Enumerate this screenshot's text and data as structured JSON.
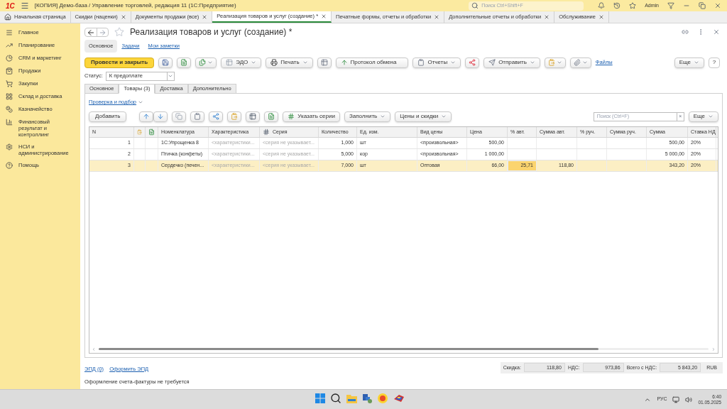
{
  "top_bar": {
    "logo": "1С",
    "title": "[КОПИЯ] Демо-база / Управление торговлей, редакция 11  (1С:Предприятие)",
    "search_placeholder": "Поиск Ctrl+Shift+F",
    "user": "Admin"
  },
  "tabs": [
    {
      "label": "Начальная страница",
      "selected": false,
      "closable": false
    },
    {
      "label": "Скидки (наценки)",
      "selected": false,
      "closable": true
    },
    {
      "label": "Документы продажи (все)",
      "selected": false,
      "closable": true
    },
    {
      "label": "Реализация товаров и услуг (создание) *",
      "selected": true,
      "closable": true
    },
    {
      "label": "Печатные формы, отчеты и обработки",
      "selected": false,
      "closable": true
    },
    {
      "label": "Дополнительные отчеты и обработки",
      "selected": false,
      "closable": true
    },
    {
      "label": "Обслуживание",
      "selected": false,
      "closable": true
    }
  ],
  "sidebar": {
    "items": [
      {
        "label": "Главное"
      },
      {
        "label": "Планирование"
      },
      {
        "label": "CRM и маркетинг"
      },
      {
        "label": "Продажи"
      },
      {
        "label": "Закупки"
      },
      {
        "label": "Склад и доставка"
      },
      {
        "label": "Казначейство"
      },
      {
        "label": "Финансовый результат и контроллинг"
      },
      {
        "label": "НСИ и администрирование"
      },
      {
        "label": "Помощь"
      }
    ]
  },
  "form": {
    "title": "Реализация товаров и услуг (создание) *",
    "sections": [
      {
        "label": "Основное",
        "selected": true
      },
      {
        "label": "Задачи",
        "selected": false
      },
      {
        "label": "Мои заметки",
        "selected": false
      }
    ],
    "toolbar": {
      "post_and_close": "Провести и закрыть",
      "edo": "ЭДО",
      "print": "Печать",
      "exchange_log": "Протокол обмена",
      "reports": "Отчеты",
      "send": "Отправить",
      "files": "Файлы",
      "more": "Еще",
      "help": "?"
    },
    "status": {
      "label": "Статус:",
      "value": "К предоплате"
    },
    "tabs": [
      {
        "label": "Основное",
        "selected": false
      },
      {
        "label": "Товары (3)",
        "selected": true
      },
      {
        "label": "Доставка",
        "selected": false
      },
      {
        "label": "Дополнительно",
        "selected": false
      }
    ],
    "check_link": "Проверка и подбор",
    "table_toolbar": {
      "add": "Добавить",
      "specify_series": "Указать серии",
      "fill": "Заполнить",
      "prices": "Цены и скидки",
      "search_placeholder": "Поиск (Ctrl+F)",
      "clear": "×",
      "more": "Еще"
    },
    "table": {
      "columns": [
        "N",
        "Номенклатура",
        "Характеристика",
        "Серия",
        "Количество",
        "Ед. изм.",
        "Вид цены",
        "Цена",
        "% авт.",
        "Сумма авт.",
        "% руч.",
        "Сумма руч.",
        "Сумма",
        "Ставка НД"
      ],
      "rows": [
        {
          "n": "1",
          "nomenclature": "1С:Упрощенка 8",
          "characteristic": "<характеристики...",
          "series": "<серия не указывает...",
          "quantity": "1,000",
          "unit": "шт",
          "price_type": "<произвольная>",
          "price": "500,00",
          "sum": "500,00",
          "vat_rate": "20%",
          "selected": false,
          "auto_percent_focused": false
        },
        {
          "n": "2",
          "nomenclature": "Птичка (конфеты)",
          "characteristic": "<характеристики...",
          "series": "<серия не указывает...",
          "quantity": "5,000",
          "unit": "кор",
          "price_type": "<произвольная>",
          "price": "1 000,00",
          "sum": "5 000,00",
          "vat_rate": "20%",
          "selected": false,
          "auto_percent_focused": false
        },
        {
          "n": "3",
          "nomenclature": "Сердечко (печен...",
          "characteristic": "<характеристики...",
          "series": "<серия не указывает...",
          "quantity": "7,000",
          "unit": "шт",
          "price_type": "Оптовая",
          "price": "66,00",
          "auto_percent": "25,71",
          "auto_sum": "118,80",
          "sum": "343,20",
          "vat_rate": "20%",
          "selected": true,
          "auto_percent_focused": true
        }
      ]
    },
    "links": [
      "ЭПД (0)",
      "Оформить ЭПД"
    ],
    "totals": [
      {
        "label": "Скидка:",
        "value": "118,80"
      },
      {
        "label": "НДС:",
        "value": "973,86"
      },
      {
        "label": "Всего с НДС:",
        "value": "5 843,20"
      }
    ],
    "currency": "RUB",
    "note": "Оформление счета-фактуры не требуется"
  },
  "taskbar": {
    "language": "РУС",
    "time": "6:40",
    "date": "01.05.2025"
  }
}
